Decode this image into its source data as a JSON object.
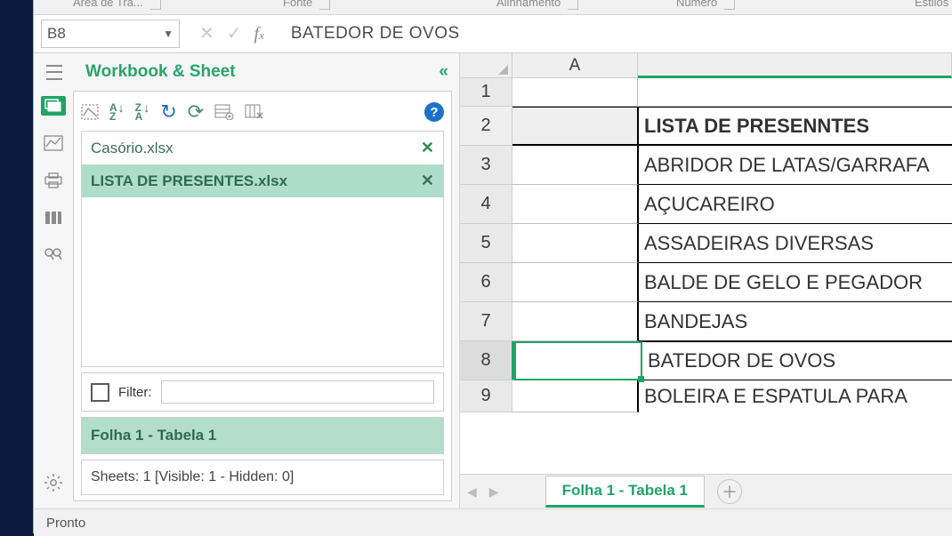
{
  "ribbon_groups": {
    "clipboard": "Área de Tra...",
    "font": "Fonte",
    "alignment": "Alinhamento",
    "number": "Número",
    "styles": "Estilos"
  },
  "namebox": "B8",
  "formula_value": "BATEDOR DE OVOS",
  "taskpane": {
    "title": "Workbook & Sheet",
    "workbooks": [
      {
        "name": "Casório.xlsx",
        "selected": false
      },
      {
        "name": "LISTA DE PRESENTES.xlsx",
        "selected": true
      }
    ],
    "filter_label": "Filter:",
    "sheet_selected": "Folha 1 - Tabela 1",
    "stats": "Sheets: 1  [Visible: 1 - Hidden: 0]"
  },
  "grid": {
    "col_label_A": "A",
    "rows": [
      {
        "n": "1",
        "val": ""
      },
      {
        "n": "2",
        "val": "LISTA DE PRESENNTES"
      },
      {
        "n": "3",
        "val": "ABRIDOR DE LATAS/GARRAFA"
      },
      {
        "n": "4",
        "val": "AÇUCAREIRO"
      },
      {
        "n": "5",
        "val": "ASSADEIRAS DIVERSAS"
      },
      {
        "n": "6",
        "val": "BALDE DE GELO E PEGADOR"
      },
      {
        "n": "7",
        "val": "BANDEJAS"
      },
      {
        "n": "8",
        "val": "BATEDOR DE OVOS"
      },
      {
        "n": "9",
        "val": "BOLEIRA  E ESPATULA PARA "
      }
    ],
    "selected_row": "8"
  },
  "sheet_tab": "Folha 1 - Tabela 1",
  "status": "Pronto"
}
